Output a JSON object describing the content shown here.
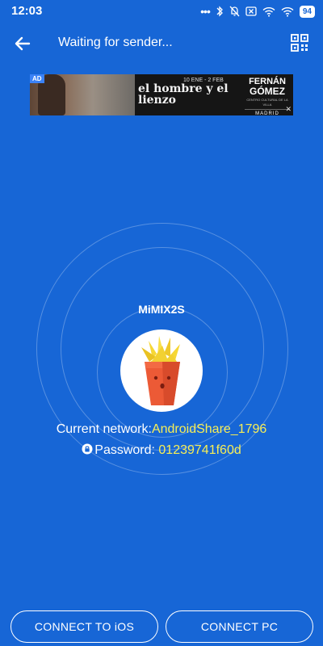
{
  "status_bar": {
    "time": "12:03",
    "battery": "94",
    "icons": [
      "more-dots-icon",
      "bluetooth-icon",
      "mute-bell-icon",
      "sim-off-icon",
      "wifi-icon",
      "wifi-icon",
      "battery-icon"
    ]
  },
  "toolbar": {
    "title": "Waiting for sender...",
    "back_icon": "arrow-left-icon",
    "qr_icon": "qr-code-icon"
  },
  "ad": {
    "badge": "AD",
    "dates": "10 ENE - 2 FEB",
    "headline": "el hombre y el lienzo",
    "brand_line1": "FERNÁN",
    "brand_line2": "GÓMEZ",
    "brand_sub": "CENTRO CULTURAL DE LA VILLA",
    "city": "MADRID",
    "close": "✕"
  },
  "device": {
    "name": "MiMIX2S",
    "avatar_icon": "fries-mascot-icon"
  },
  "network": {
    "label": "Current network:",
    "value": "AndroidShare_1796"
  },
  "password": {
    "label": "Password: ",
    "value": "01239741f60d"
  },
  "buttons": {
    "ios": "CONNECT TO iOS",
    "pc": "CONNECT PC"
  },
  "colors": {
    "background": "#1766d6",
    "highlight": "#f7ee55"
  }
}
